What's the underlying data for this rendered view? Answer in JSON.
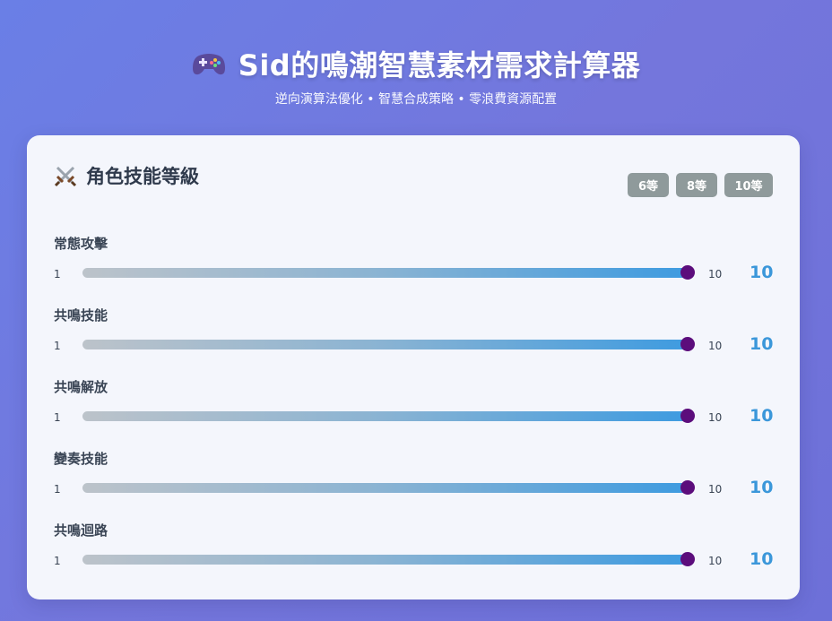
{
  "header": {
    "title": "Sid的鳴潮智慧素材需求計算器",
    "subtitle": "逆向演算法優化 • 智慧合成策略 • 零浪費資源配置",
    "icon": "gamepad-icon"
  },
  "card": {
    "title": "角色技能等級",
    "icon": "crossed-swords-icon",
    "level_buttons": [
      "6等",
      "8等",
      "10等"
    ]
  },
  "skills": [
    {
      "name": "常態攻擊",
      "min": "1",
      "max": "10",
      "value": "10"
    },
    {
      "name": "共鳴技能",
      "min": "1",
      "max": "10",
      "value": "10"
    },
    {
      "name": "共鳴解放",
      "min": "1",
      "max": "10",
      "value": "10"
    },
    {
      "name": "變奏技能",
      "min": "1",
      "max": "10",
      "value": "10"
    },
    {
      "name": "共鳴迴路",
      "min": "1",
      "max": "10",
      "value": "10"
    }
  ],
  "colors": {
    "accent": "#3b97da",
    "thumb": "#5c0d7c",
    "button": "#8f9a9b"
  }
}
